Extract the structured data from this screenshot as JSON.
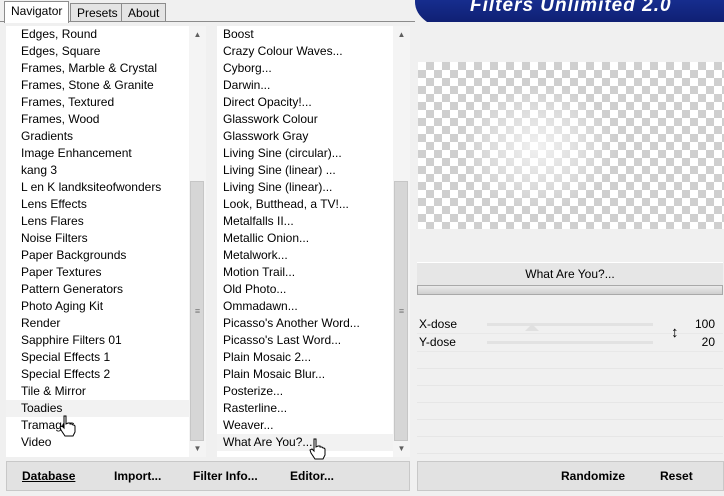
{
  "tabs": [
    {
      "label": "Navigator",
      "active": true
    },
    {
      "label": "Presets",
      "active": false
    },
    {
      "label": "About",
      "active": false
    }
  ],
  "header": {
    "title": "Filters Unlimited 2.0"
  },
  "categories": [
    "Edges, Round",
    "Edges, Square",
    "Frames, Marble & Crystal",
    "Frames, Stone & Granite",
    "Frames, Textured",
    "Frames, Wood",
    "Gradients",
    "Image Enhancement",
    "kang 3",
    "L en K landksiteofwonders",
    "Lens Effects",
    "Lens Flares",
    "Noise Filters",
    "Paper Backgrounds",
    "Paper Textures",
    "Pattern Generators",
    "Photo Aging Kit",
    "Render",
    "Sapphire Filters 01",
    "Special Effects 1",
    "Special Effects 2",
    "Tile & Mirror",
    "Toadies",
    "Tramages",
    "Video"
  ],
  "filters": [
    "Boost",
    "Crazy Colour Waves...",
    "Cyborg...",
    "Darwin...",
    "Direct Opacity!...",
    "Glasswork Colour",
    "Glasswork Gray",
    "Living Sine (circular)...",
    "Living Sine (linear) ...",
    "Living Sine (linear)...",
    "Look, Butthead, a TV!...",
    "Metalfalls II...",
    "Metallic Onion...",
    "Metalwork...",
    "Motion Trail...",
    "Old Photo...",
    "Ommadawn...",
    "Picasso's Another Word...",
    "Picasso's Last Word...",
    "Plain Mosaic 2...",
    "Plain Mosaic Blur...",
    "Posterize...",
    "Rasterline...",
    "Weaver...",
    "What Are You?..."
  ],
  "filter_panel": {
    "title": "What Are You?...",
    "params": [
      {
        "name": "X-dose",
        "value": "100"
      },
      {
        "name": "Y-dose",
        "value": "20"
      }
    ]
  },
  "buttons": {
    "database": "Database",
    "import": "Import...",
    "filter_info": "Filter Info...",
    "editor": "Editor...",
    "randomize": "Randomize",
    "reset": "Reset"
  }
}
